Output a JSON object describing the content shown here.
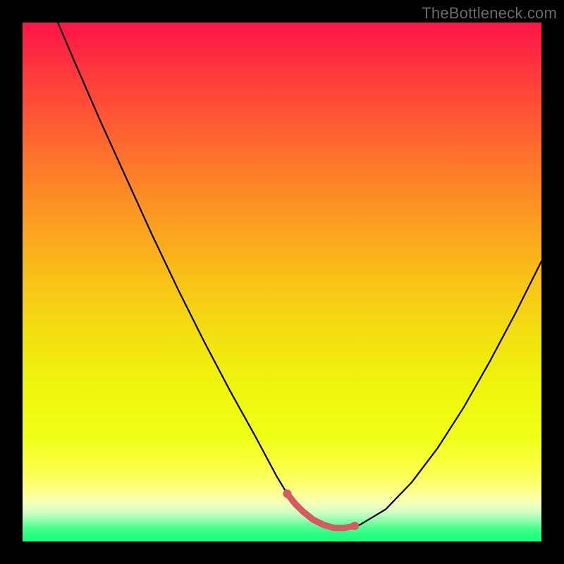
{
  "watermark": {
    "text": "TheBottleneck.com"
  },
  "colors": {
    "background": "#000000",
    "curve": "#000000",
    "marker": "#d65a5f",
    "gradientStops": [
      {
        "offset": 0.0,
        "hex": "#fd1747"
      },
      {
        "offset": 0.03,
        "hex": "#fd1f44"
      },
      {
        "offset": 0.1,
        "hex": "#fe3a3c"
      },
      {
        "offset": 0.2,
        "hex": "#fe5d32"
      },
      {
        "offset": 0.3,
        "hex": "#fd8128"
      },
      {
        "offset": 0.4,
        "hex": "#fba31f"
      },
      {
        "offset": 0.5,
        "hex": "#f8c317"
      },
      {
        "offset": 0.6,
        "hex": "#f3df10"
      },
      {
        "offset": 0.7,
        "hex": "#eef50b"
      },
      {
        "offset": 0.8,
        "hex": "#f1ff17"
      },
      {
        "offset": 0.86,
        "hex": "#fbff46"
      },
      {
        "offset": 0.887,
        "hex": "#ffff6d"
      },
      {
        "offset": 0.913,
        "hex": "#fcffa0"
      },
      {
        "offset": 0.93,
        "hex": "#eeffbe"
      },
      {
        "offset": 0.945,
        "hex": "#cdffc3"
      },
      {
        "offset": 0.955,
        "hex": "#a3ffb4"
      },
      {
        "offset": 0.965,
        "hex": "#74ffa0"
      },
      {
        "offset": 0.975,
        "hex": "#4aff8f"
      },
      {
        "offset": 0.985,
        "hex": "#2bff83"
      },
      {
        "offset": 1.0,
        "hex": "#18ff7b"
      }
    ]
  },
  "chart_data": {
    "type": "line",
    "title": "",
    "xlabel": "",
    "ylabel": "",
    "xlim": [
      0,
      100
    ],
    "ylim": [
      0,
      100
    ],
    "grid": false,
    "legend": false,
    "series": [
      {
        "name": "bottleneck-curve",
        "x": [
          6.8,
          10,
          15,
          20,
          25,
          30,
          35,
          40,
          45,
          49,
          51,
          52.5,
          54,
          56,
          58,
          60,
          62,
          65,
          70,
          75,
          80,
          85,
          90,
          95,
          100
        ],
        "y": [
          100,
          92.5,
          81,
          70,
          59,
          48.5,
          38.5,
          29,
          20,
          12.5,
          9.2,
          7.3,
          5.8,
          4.2,
          3.2,
          2.6,
          2.6,
          3.2,
          6.2,
          11.4,
          18.0,
          25.8,
          34.6,
          44.0,
          54.0
        ]
      }
    ],
    "highlight_segment": {
      "name": "optimal-range",
      "x": [
        51.0,
        52.5,
        54.0,
        56.0,
        58.0,
        60.0,
        62.0,
        64.0
      ],
      "y": [
        9.2,
        7.3,
        5.8,
        4.2,
        3.2,
        2.6,
        2.6,
        3.0
      ]
    }
  }
}
